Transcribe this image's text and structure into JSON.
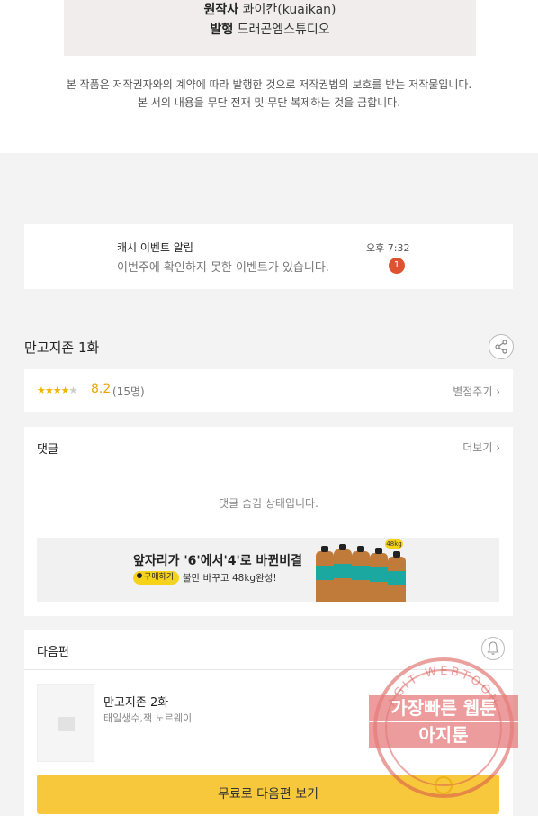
{
  "credits": {
    "original_label": "원작사",
    "original_value": "콰이칸(kuaikan)",
    "publisher_label": "발행",
    "publisher_value": "드래곤엠스튜디오"
  },
  "copyright": {
    "line1": "본 작품은 저작권자와의 계약에 따라 발행한 것으로 저작권법의 보호를 받는 저작물입니다.",
    "line2": "본 서의 내용을 무단 전재 및 무단 복제하는 것을 금합니다."
  },
  "notification": {
    "title": "캐시 이벤트 알림",
    "message": "이번주에 확인하지 못한 이벤트가 있습니다.",
    "time": "오후 7:32",
    "badge_count": "1"
  },
  "episode": {
    "title": "만고지존 1화",
    "share_icon": "share-icon"
  },
  "rating": {
    "stars_filled": 4,
    "stars_total": 5,
    "score": "8.2",
    "count": "(15명)",
    "rate_link": "별점주기 ›"
  },
  "comments": {
    "title": "댓글",
    "more": "더보기 ›",
    "hidden_message": "댓글 숨김 상태입니다."
  },
  "ad": {
    "headline": "앞자리가 '6'에서'4'로 바뀐비결",
    "button": "구매하기",
    "sub": "불만 바꾸고 48kg완성!",
    "badge": "48kg"
  },
  "next_episode": {
    "section_title": "다음편",
    "title": "만고지존 2화",
    "authors": "태일생수,잭 노르웨이",
    "button": "무료로 다음편 보기",
    "bell_icon": "bell-icon"
  },
  "watermark": {
    "ring_text": "AGIT WEBTOON",
    "line1": "가장빠른 웹툰",
    "line2": "아지툰"
  },
  "colors": {
    "accent_yellow": "#f7c83b",
    "badge_red": "#e0522f",
    "star_gold": "#f0b400",
    "watermark_red": "#d9534f"
  }
}
